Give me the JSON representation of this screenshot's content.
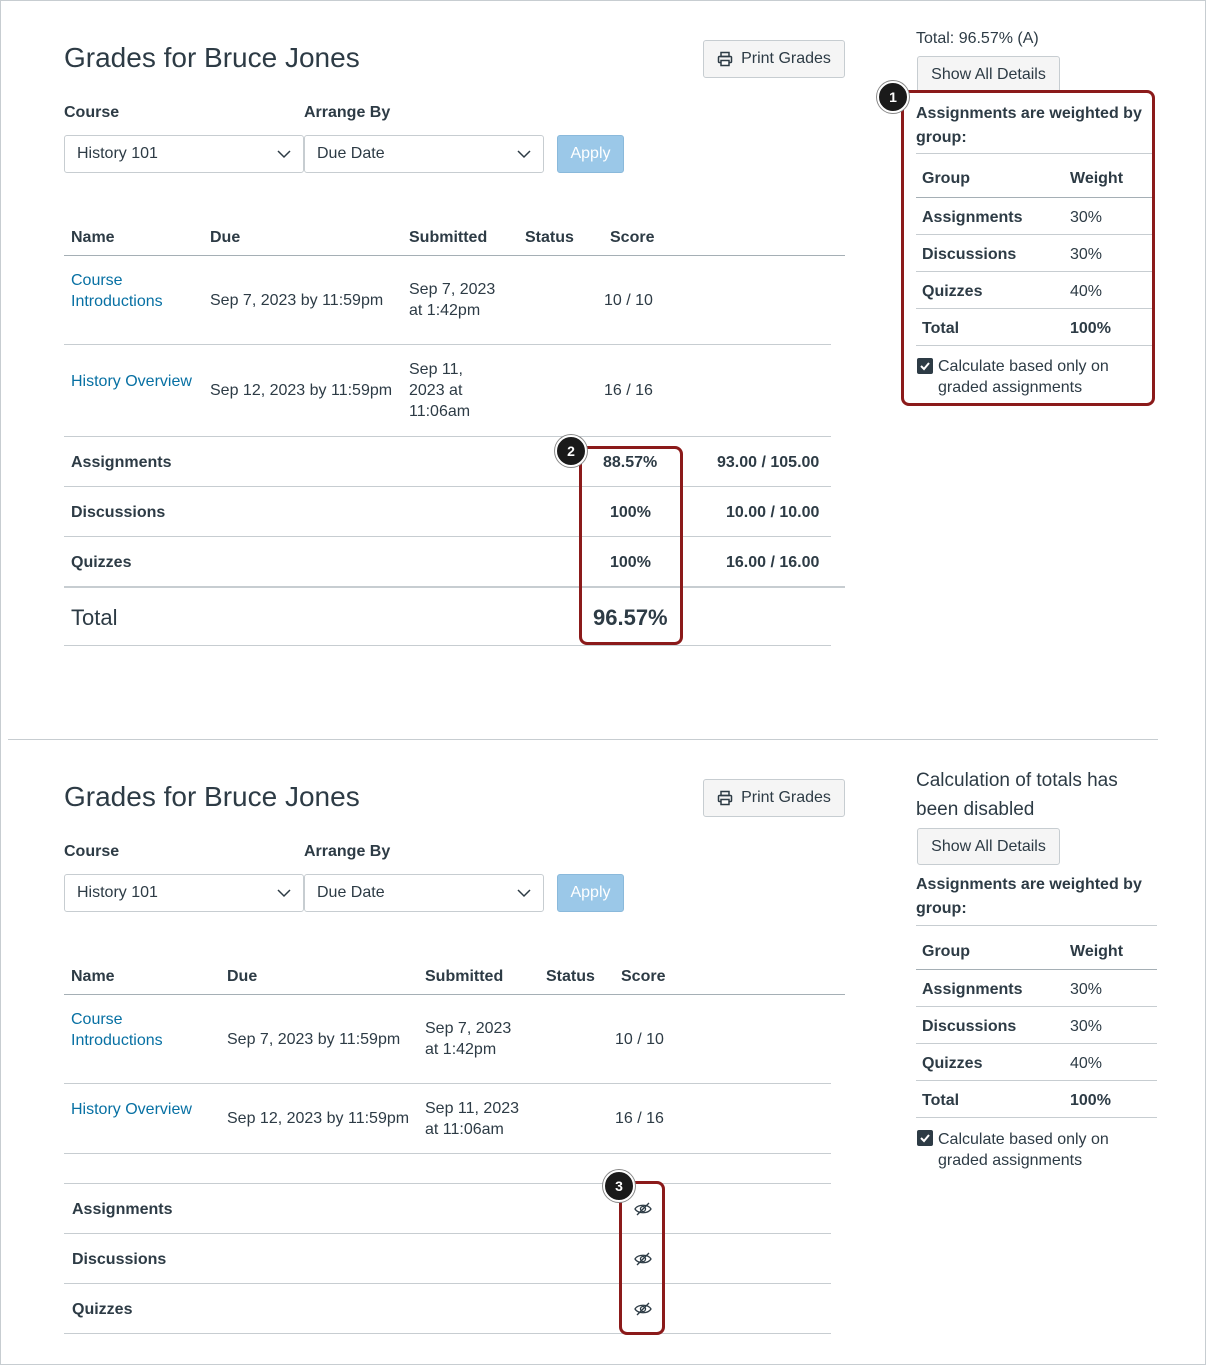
{
  "top": {
    "title": "Grades for Bruce Jones",
    "print_label": "Print Grades",
    "course_label": "Course",
    "course_value": "History 101",
    "arrange_label": "Arrange By",
    "arrange_value": "Due Date",
    "apply_label": "Apply",
    "headers": {
      "name": "Name",
      "due": "Due",
      "submitted": "Submitted",
      "status": "Status",
      "score": "Score"
    },
    "rows": [
      {
        "name_l1": "Course",
        "name_l2": "Introductions",
        "due": "Sep 7, 2023 by 11:59pm",
        "sub_l1": "Sep 7, 2023",
        "sub_l2": "at 1:42pm",
        "sub_l3": "",
        "score": "10 / 10"
      },
      {
        "name_l1": "History Overview",
        "name_l2": "",
        "due": "Sep 12, 2023 by 11:59pm",
        "sub_l1": "Sep 11,",
        "sub_l2": "2023 at",
        "sub_l3": "11:06am",
        "score": "16 / 16"
      }
    ],
    "groups": [
      {
        "name": "Assignments",
        "pct": "88.57%",
        "pts": "93.00 / 105.00"
      },
      {
        "name": "Discussions",
        "pct": "100%",
        "pts": "10.00 / 10.00"
      },
      {
        "name": "Quizzes",
        "pct": "100%",
        "pts": "16.00 / 16.00"
      }
    ],
    "total_label": "Total",
    "total_value": "96.57%",
    "sidebar": {
      "total_text": "Total: 96.57% (A)",
      "show_details": "Show All Details",
      "weighted_l1": "Assignments are weighted by",
      "weighted_l2": "group:",
      "col_group": "Group",
      "col_weight": "Weight",
      "weights": [
        {
          "group": "Assignments",
          "weight": "30%"
        },
        {
          "group": "Discussions",
          "weight": "30%"
        },
        {
          "group": "Quizzes",
          "weight": "40%"
        }
      ],
      "total_group": "Total",
      "total_weight": "100%",
      "calc_l1": "Calculate based only on",
      "calc_l2": "graded assignments"
    },
    "badge1": "1",
    "badge2": "2"
  },
  "bottom": {
    "title": "Grades for Bruce Jones",
    "print_label": "Print Grades",
    "course_label": "Course",
    "course_value": "History 101",
    "arrange_label": "Arrange By",
    "arrange_value": "Due Date",
    "apply_label": "Apply",
    "headers": {
      "name": "Name",
      "due": "Due",
      "submitted": "Submitted",
      "status": "Status",
      "score": "Score"
    },
    "rows": [
      {
        "name_l1": "Course",
        "name_l2": "Introductions",
        "due": "Sep 7, 2023 by 11:59pm",
        "sub_l1": "Sep 7, 2023",
        "sub_l2": "at 1:42pm",
        "score": "10 / 10"
      },
      {
        "name_l1": "History Overview",
        "name_l2": "",
        "due": "Sep 12, 2023 by 11:59pm",
        "sub_l1": "Sep 11, 2023",
        "sub_l2": "at 11:06am",
        "score": "16 / 16"
      }
    ],
    "groups": [
      {
        "name": "Assignments"
      },
      {
        "name": "Discussions"
      },
      {
        "name": "Quizzes"
      }
    ],
    "sidebar": {
      "disabled_l1": "Calculation of totals has",
      "disabled_l2": "been disabled",
      "show_details": "Show All Details",
      "weighted_l1": "Assignments are weighted by",
      "weighted_l2": "group:",
      "col_group": "Group",
      "col_weight": "Weight",
      "weights": [
        {
          "group": "Assignments",
          "weight": "30%"
        },
        {
          "group": "Discussions",
          "weight": "30%"
        },
        {
          "group": "Quizzes",
          "weight": "40%"
        }
      ],
      "total_group": "Total",
      "total_weight": "100%",
      "calc_l1": "Calculate based only on",
      "calc_l2": "graded assignments"
    },
    "badge3": "3"
  },
  "colors": {
    "link": "#0770a3",
    "callout": "#8b1a1a",
    "apply": "#9bc8e8",
    "text": "#2d3b45"
  },
  "icons": [
    "printer-icon",
    "chevron-down-icon",
    "checkbox-checked-icon",
    "eye-slash-icon"
  ]
}
